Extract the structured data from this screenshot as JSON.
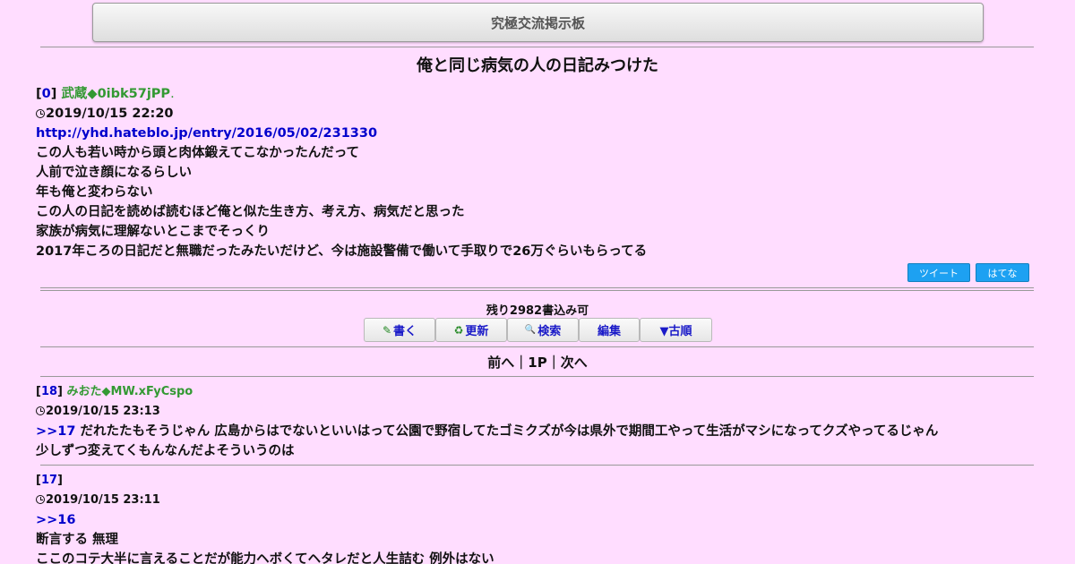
{
  "header": {
    "title": "究極交流掲示板"
  },
  "thread": {
    "title": "俺と同じ病気の人の日記みつけた"
  },
  "first_post": {
    "num": "0",
    "name": "武蔵◆0ibk57jPP",
    "name_suffix": ".",
    "date": "2019/10/15 22:20",
    "link": "http://yhd.hateblo.jp/entry/2016/05/02/231330",
    "lines": [
      "この人も若い時から頭と肉体鍛えてこなかったんだって",
      "人前で泣き顔になるらしい",
      "年も俺と変わらない",
      "この人の日記を読めば読むほど俺と似た生き方、考え方、病気だと思った",
      "家族が病気に理解ないとこまでそっくり",
      "2017年ころの日記だと無職だったみたいだけど、今は施設警備で働いて手取りで26万ぐらいもらってる"
    ]
  },
  "share": {
    "tweet": "ツイート",
    "hatena": "はてな"
  },
  "board": {
    "remaining": "残り2982書込み可",
    "buttons": {
      "write_icon": "✎",
      "write": "書く",
      "refresh_icon": "♻",
      "refresh": "更新",
      "search_icon": "🔍",
      "search": "検索",
      "edit": "編集",
      "old": "▼古順"
    },
    "pager": {
      "prev": "前へ",
      "sep": "｜",
      "page": "1P",
      "next": "次へ"
    }
  },
  "replies": [
    {
      "num": "18",
      "name": "みおた◆MW.xFyCspo",
      "date": "2019/10/15 23:13",
      "anchor": ">>17",
      "lines": [
        " だれたたもそうじゃん 広島からはでないといいはって公園で野宿してたゴミクズが今は県外で期間工やって生活がマシになってクズやってるじゃん",
        "少しずつ変えてくもんなんだよそういうのは"
      ]
    },
    {
      "num": "17",
      "date": "2019/10/15 23:11",
      "anchor": ">>16",
      "lines": [
        "断言する 無理",
        "ここのコテ大半に言えることだが能力ヘボくてヘタレだと人生詰む 例外はない"
      ]
    }
  ]
}
